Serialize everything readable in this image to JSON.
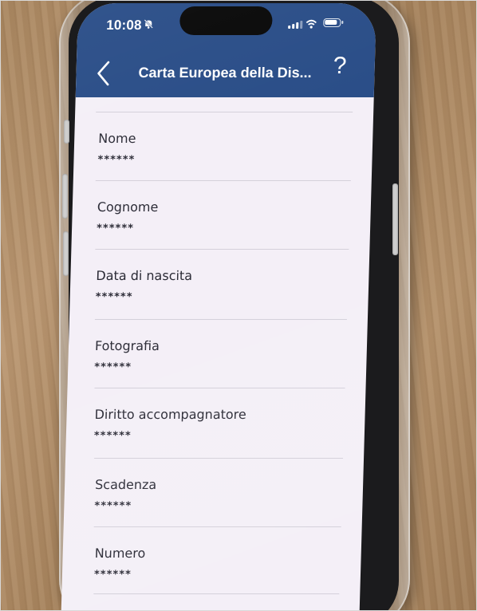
{
  "status_bar": {
    "time": "10:08",
    "icons": [
      "bell-slash-icon",
      "signal-icon",
      "wifi-icon",
      "battery-icon"
    ]
  },
  "nav": {
    "title": "Carta Europea della Dis...",
    "back_icon": "chevron-left-icon",
    "help_label": "?"
  },
  "fields": [
    {
      "label": "Nome",
      "value": "******"
    },
    {
      "label": "Cognome",
      "value": "******"
    },
    {
      "label": "Data di nascita",
      "value": "******"
    },
    {
      "label": "Fotografia",
      "value": "******"
    },
    {
      "label": "Diritto accompagnatore",
      "value": "******"
    },
    {
      "label": "Scadenza",
      "value": "******"
    },
    {
      "label": "Numero",
      "value": "******"
    }
  ],
  "colors": {
    "header": "#274b86",
    "screen_background": "#f4eff7",
    "text": "#2a2a35"
  }
}
